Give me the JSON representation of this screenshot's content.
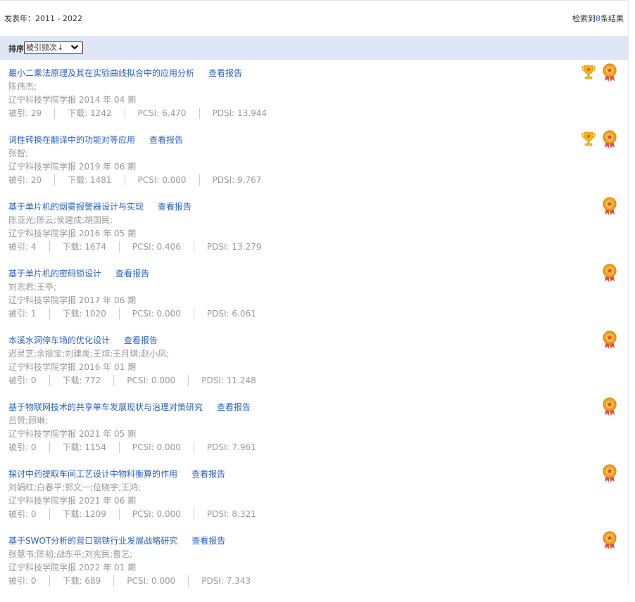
{
  "filter": {
    "year_text": "发表年：2011 - 2022",
    "result_prefix": "检索到",
    "result_count": "8",
    "result_suffix": "条结果"
  },
  "sort": {
    "label": "排序",
    "selected": "被引频次↓"
  },
  "report_label": "查看报告",
  "stat_labels": {
    "cited": "被引: ",
    "download": "下载: ",
    "pcsi": "PCSI: ",
    "pdsi": "PDSI: "
  },
  "colors": {
    "link": "#2a62c6",
    "muted": "#999999",
    "sort_bar_bg": "#dfe7f6"
  },
  "items": [
    {
      "title": "最小二乘法原理及其在实验曲线拟合中的应用分析",
      "authors": "陈伟杰;",
      "journal": "辽宁科技学院学报 2014 年 04 期",
      "cited": "29",
      "download": "1242",
      "pcsi": "6.470",
      "pdsi": "13.944",
      "badges": [
        "trophy-icon",
        "medal-icon"
      ]
    },
    {
      "title": "词性转换在翻译中的功能对等应用",
      "authors": "张智;",
      "journal": "辽宁科技学院学报 2019 年 06 期",
      "cited": "20",
      "download": "1481",
      "pcsi": "0.000",
      "pdsi": "9.767",
      "badges": [
        "trophy-icon",
        "medal-icon"
      ]
    },
    {
      "title": "基于单片机的烟雾报警器设计与实现",
      "authors": "陈亚光;陈云;侯建成;胡国民;",
      "journal": "辽宁科技学院学报 2016 年 05 期",
      "cited": "4",
      "download": "1674",
      "pcsi": "0.406",
      "pdsi": "13.279",
      "badges": [
        "medal-icon"
      ]
    },
    {
      "title": "基于单片机的密码锁设计",
      "authors": "刘志君;王亭;",
      "journal": "辽宁科技学院学报 2017 年 06 期",
      "cited": "1",
      "download": "1020",
      "pcsi": "0.000",
      "pdsi": "6.061",
      "badges": [
        "medal-icon"
      ]
    },
    {
      "title": "本溪水洞停车场的优化设计",
      "authors": "迟灵芝;余振宝;刘建禹;王煊;王月琪;赵小凤;",
      "journal": "辽宁科技学院学报 2016 年 01 期",
      "cited": "0",
      "download": "772",
      "pcsi": "0.000",
      "pdsi": "11.248",
      "badges": [
        "medal-icon"
      ]
    },
    {
      "title": "基于物联网技术的共享单车发展现状与治理对策研究",
      "authors": "吕赞;顾琳;",
      "journal": "辽宁科技学院学报 2021 年 05 期",
      "cited": "0",
      "download": "1154",
      "pcsi": "0.000",
      "pdsi": "7.961",
      "badges": [
        "medal-icon"
      ]
    },
    {
      "title": "探讨中药提取车间工艺设计中物料衡算的作用",
      "authors": "刘娟红;白春平;郭文一;位晓宇;王鸿;",
      "journal": "辽宁科技学院学报 2021 年 06 期",
      "cited": "0",
      "download": "1209",
      "pcsi": "0.000",
      "pdsi": "8.321",
      "badges": [
        "medal-icon"
      ]
    },
    {
      "title": "基于SWOT分析的营口钢铁行业发展战略研究",
      "authors": "张慧书;陈韧;战东平;刘宪民;曹艺;",
      "journal": "辽宁科技学院学报 2022 年 01 期",
      "cited": "0",
      "download": "689",
      "pcsi": "0.000",
      "pdsi": "7.343",
      "badges": [
        "medal-icon"
      ]
    }
  ]
}
